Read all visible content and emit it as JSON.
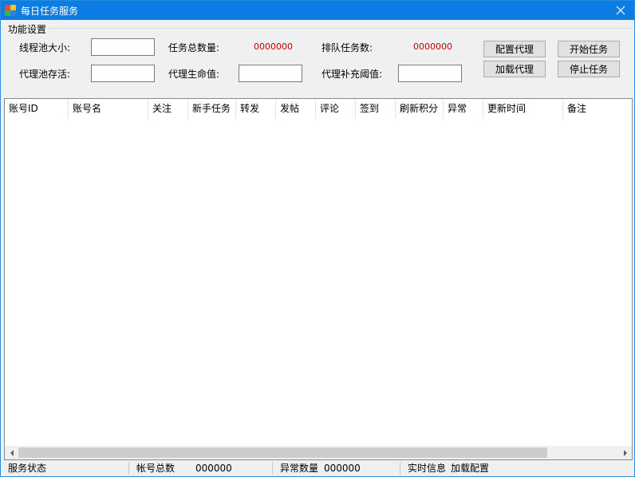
{
  "window": {
    "title": "每日任务服务"
  },
  "colors": {
    "titlebar": "#0b7de3",
    "value_red": "#c00000"
  },
  "icons": {
    "app": "app-logo-icon",
    "close": "close-icon"
  },
  "settings": {
    "group_label": "功能设置",
    "thread_pool_label": "线程池大小:",
    "thread_pool_value": "",
    "proxy_survival_label": "代理池存活:",
    "proxy_survival_value": "",
    "total_tasks_label": "任务总数量:",
    "total_tasks_value": "0000000",
    "proxy_life_label": "代理生命值:",
    "proxy_life_value": "",
    "queued_tasks_label": "排队任务数:",
    "queued_tasks_value": "0000000",
    "proxy_threshold_label": "代理补充阈值:",
    "proxy_threshold_value": ""
  },
  "buttons": {
    "config_proxy": "配置代理",
    "load_proxy": "加载代理",
    "start_task": "开始任务",
    "stop_task": "停止任务"
  },
  "table": {
    "columns": [
      "账号ID",
      "账号名",
      "关注",
      "新手任务",
      "转发",
      "发帖",
      "评论",
      "签到",
      "刷新积分",
      "异常",
      "更新时间",
      "备注"
    ],
    "rows": []
  },
  "status": {
    "service_label": "服务状态",
    "accounts_label": "帐号总数",
    "accounts_value": "000000",
    "errors_label": "异常数量",
    "errors_value": "000000",
    "realtime_label": "实时信息",
    "realtime_value": "加载配置"
  }
}
